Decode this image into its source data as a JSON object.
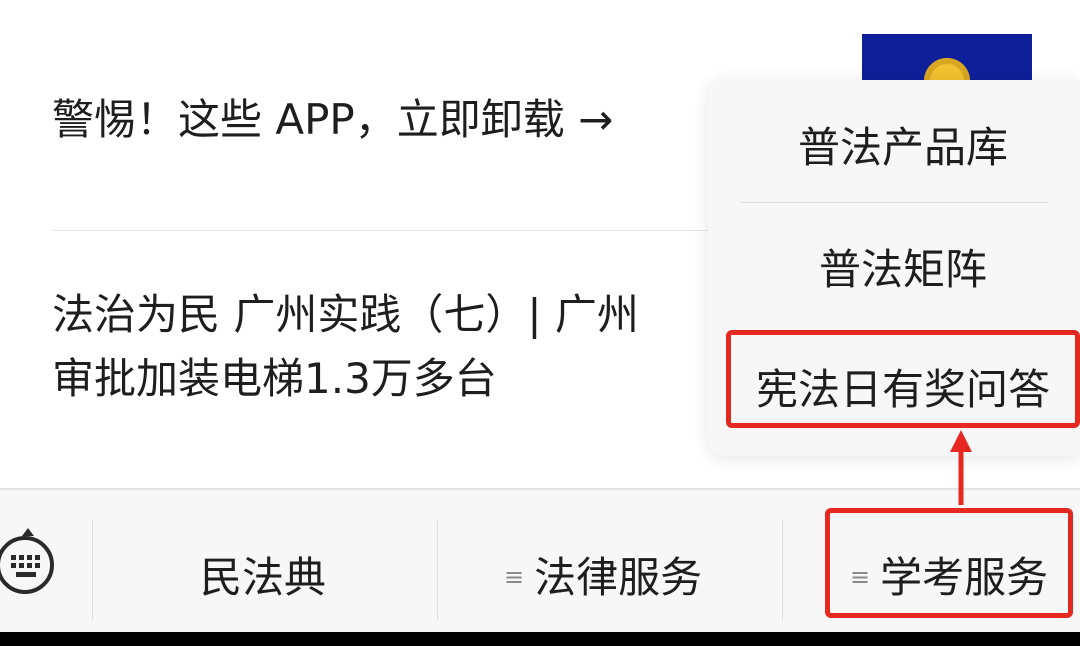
{
  "articles": [
    {
      "title": "警惕！这些 APP，立即卸载 →"
    },
    {
      "title_line1": "法治为民 广州实践（七）| 广州",
      "title_line2": "审批加装电梯1.3万多台"
    }
  ],
  "popup_menu": {
    "items": [
      {
        "label": "普法产品库"
      },
      {
        "label": "普法矩阵"
      },
      {
        "label": "宪法日有奖问答"
      }
    ]
  },
  "tabbar": {
    "keyboard_icon": "keyboard-icon",
    "tabs": [
      {
        "label": "民法典",
        "has_menu": false
      },
      {
        "label": "法律服务",
        "has_menu": true,
        "menu_glyph": "≡"
      },
      {
        "label": "学考服务",
        "has_menu": true,
        "menu_glyph": "≡"
      }
    ]
  },
  "colors": {
    "highlight": "#e52820",
    "thumbnail_bg": "#0f1f9a"
  }
}
